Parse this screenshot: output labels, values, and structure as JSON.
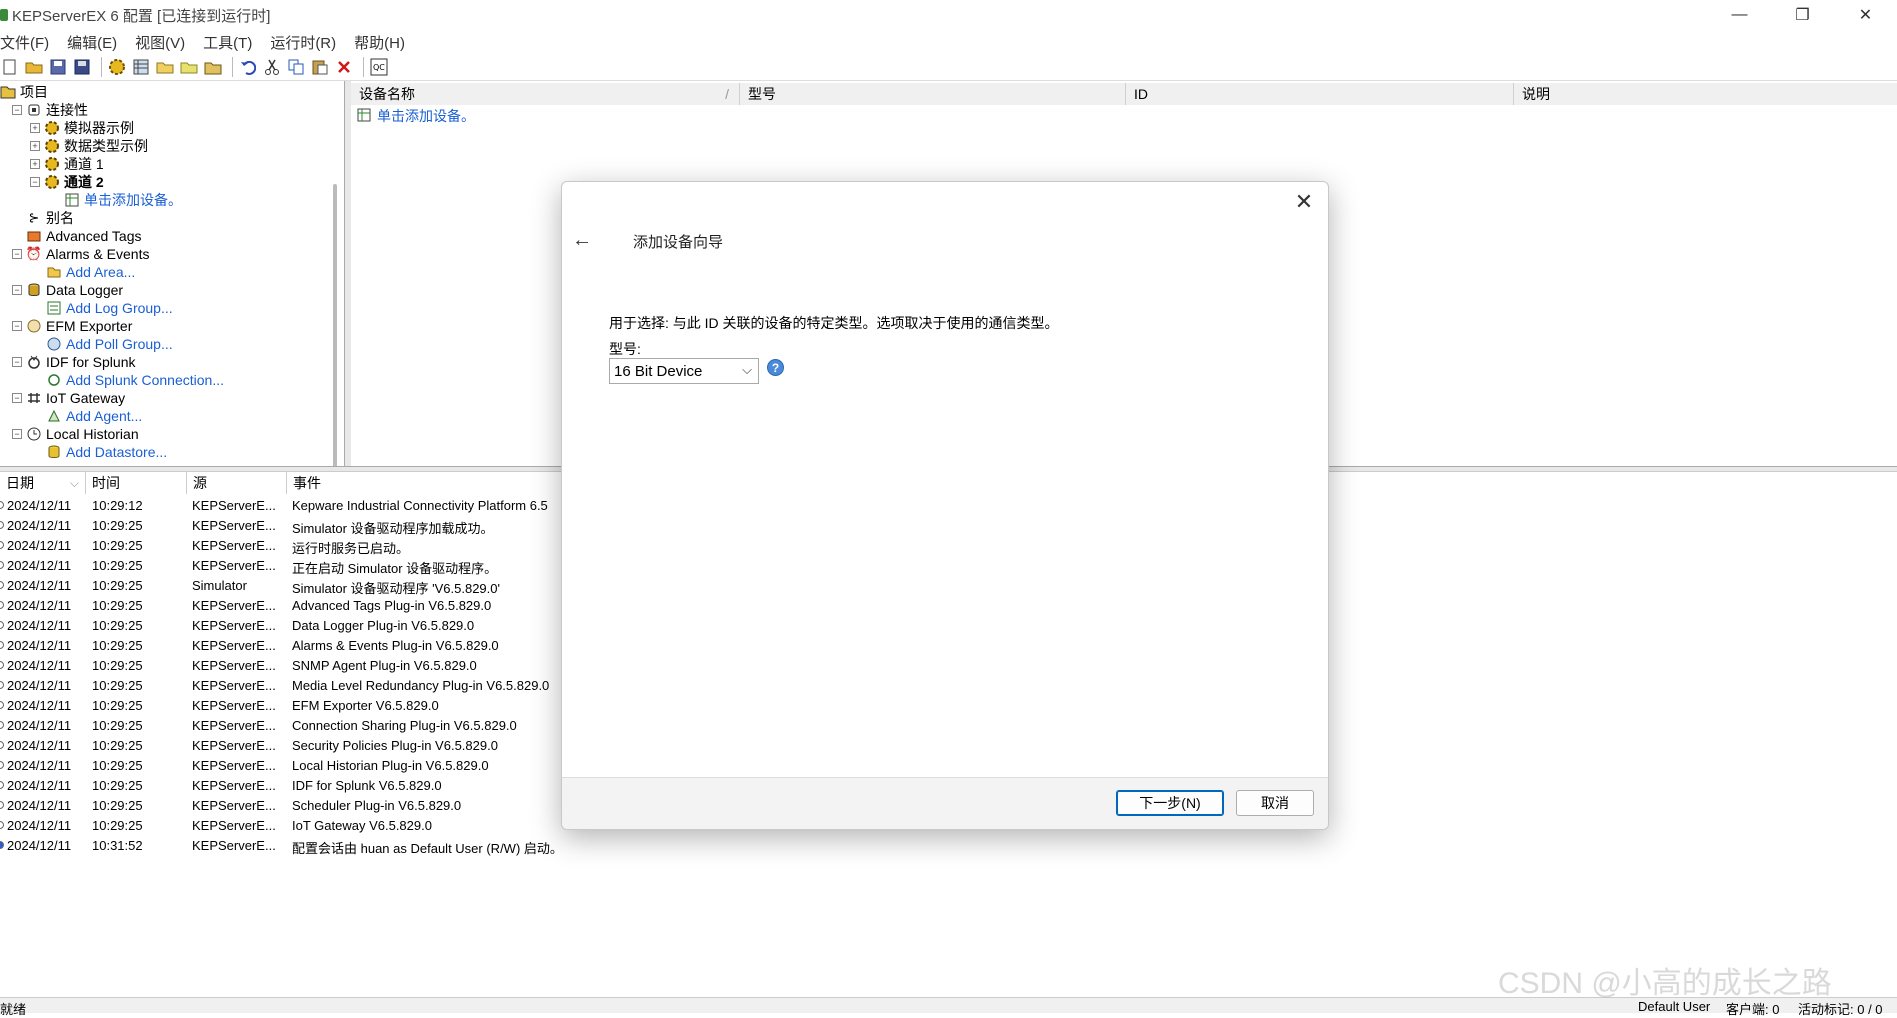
{
  "window": {
    "title": "KEPServerEX 6 配置 [已连接到运行时]",
    "minimize": "—",
    "restore": "❐",
    "close": "✕"
  },
  "menu": [
    "文件(F)",
    "编辑(E)",
    "视图(V)",
    "工具(T)",
    "运行时(R)",
    "帮助(H)"
  ],
  "toolbar": {
    "icons": [
      "new-icon",
      "open-icon",
      "save-icon",
      "save-as-icon",
      "new-channel-icon",
      "new-device-icon",
      "new-group-icon",
      "new-tag-icon",
      "bulk-tag-icon",
      "undo-icon",
      "cut-icon",
      "copy-icon",
      "paste-icon",
      "delete-icon",
      "quick-client-icon"
    ]
  },
  "tree": {
    "project": "项目",
    "connectivity": "连接性",
    "channels": [
      "模拟器示例",
      "数据类型示例",
      "通道 1",
      "通道 2"
    ],
    "add_device": "单击添加设备。",
    "alias": "别名",
    "advanced_tags": "Advanced Tags",
    "alarms": "Alarms & Events",
    "add_area": "Add Area...",
    "data_logger": "Data Logger",
    "add_log_group": "Add Log Group...",
    "efm": "EFM Exporter",
    "add_poll_group": "Add Poll Group...",
    "idf": "IDF for Splunk",
    "add_splunk": "Add Splunk Connection...",
    "iot": "IoT Gateway",
    "add_agent": "Add Agent...",
    "historian": "Local Historian",
    "add_datastore": "Add Datastore..."
  },
  "device_list": {
    "headers": [
      "设备名称",
      "型号",
      "ID",
      "说明"
    ],
    "sort_glyph": "/",
    "add_device": "单击添加设备。"
  },
  "log": {
    "headers": [
      "日期",
      "时间",
      "源",
      "事件"
    ],
    "rows": [
      {
        "date": "2024/12/11",
        "time": "10:29:12",
        "source": "KEPServerE...",
        "event": "Kepware Industrial Connectivity Platform 6.5"
      },
      {
        "date": "2024/12/11",
        "time": "10:29:25",
        "source": "KEPServerE...",
        "event": "Simulator 设备驱动程序加载成功。"
      },
      {
        "date": "2024/12/11",
        "time": "10:29:25",
        "source": "KEPServerE...",
        "event": "运行时服务已启动。"
      },
      {
        "date": "2024/12/11",
        "time": "10:29:25",
        "source": "KEPServerE...",
        "event": "正在启动 Simulator 设备驱动程序。"
      },
      {
        "date": "2024/12/11",
        "time": "10:29:25",
        "source": "Simulator",
        "event": "Simulator 设备驱动程序 'V6.5.829.0'"
      },
      {
        "date": "2024/12/11",
        "time": "10:29:25",
        "source": "KEPServerE...",
        "event": "Advanced Tags Plug-in V6.5.829.0"
      },
      {
        "date": "2024/12/11",
        "time": "10:29:25",
        "source": "KEPServerE...",
        "event": "Data Logger Plug-in V6.5.829.0"
      },
      {
        "date": "2024/12/11",
        "time": "10:29:25",
        "source": "KEPServerE...",
        "event": "Alarms & Events Plug-in V6.5.829.0"
      },
      {
        "date": "2024/12/11",
        "time": "10:29:25",
        "source": "KEPServerE...",
        "event": "SNMP Agent Plug-in V6.5.829.0"
      },
      {
        "date": "2024/12/11",
        "time": "10:29:25",
        "source": "KEPServerE...",
        "event": "Media Level Redundancy Plug-in V6.5.829.0"
      },
      {
        "date": "2024/12/11",
        "time": "10:29:25",
        "source": "KEPServerE...",
        "event": "EFM Exporter V6.5.829.0"
      },
      {
        "date": "2024/12/11",
        "time": "10:29:25",
        "source": "KEPServerE...",
        "event": "Connection Sharing Plug-in V6.5.829.0"
      },
      {
        "date": "2024/12/11",
        "time": "10:29:25",
        "source": "KEPServerE...",
        "event": "Security Policies Plug-in V6.5.829.0"
      },
      {
        "date": "2024/12/11",
        "time": "10:29:25",
        "source": "KEPServerE...",
        "event": "Local Historian Plug-in V6.5.829.0"
      },
      {
        "date": "2024/12/11",
        "time": "10:29:25",
        "source": "KEPServerE...",
        "event": "IDF for Splunk V6.5.829.0"
      },
      {
        "date": "2024/12/11",
        "time": "10:29:25",
        "source": "KEPServerE...",
        "event": "Scheduler Plug-in V6.5.829.0"
      },
      {
        "date": "2024/12/11",
        "time": "10:29:25",
        "source": "KEPServerE...",
        "event": "IoT Gateway V6.5.829.0"
      },
      {
        "date": "2024/12/11",
        "time": "10:31:52",
        "source": "KEPServerE...",
        "event": "配置会话由 huan as Default User (R/W) 启动。"
      }
    ]
  },
  "status": {
    "ready": "就绪",
    "user": "Default User",
    "clients": "客户端: 0",
    "active_tags": "活动标记: 0 / 0"
  },
  "watermark": "CSDN @小高的成长之路",
  "dialog": {
    "title": "添加设备向导",
    "description": "用于选择: 与此 ID 关联的设备的特定类型。选项取决于使用的通信类型。",
    "model_label": "型号:",
    "model_value": "16 Bit Device",
    "help": "?",
    "next": "下一步(N)",
    "cancel": "取消"
  }
}
